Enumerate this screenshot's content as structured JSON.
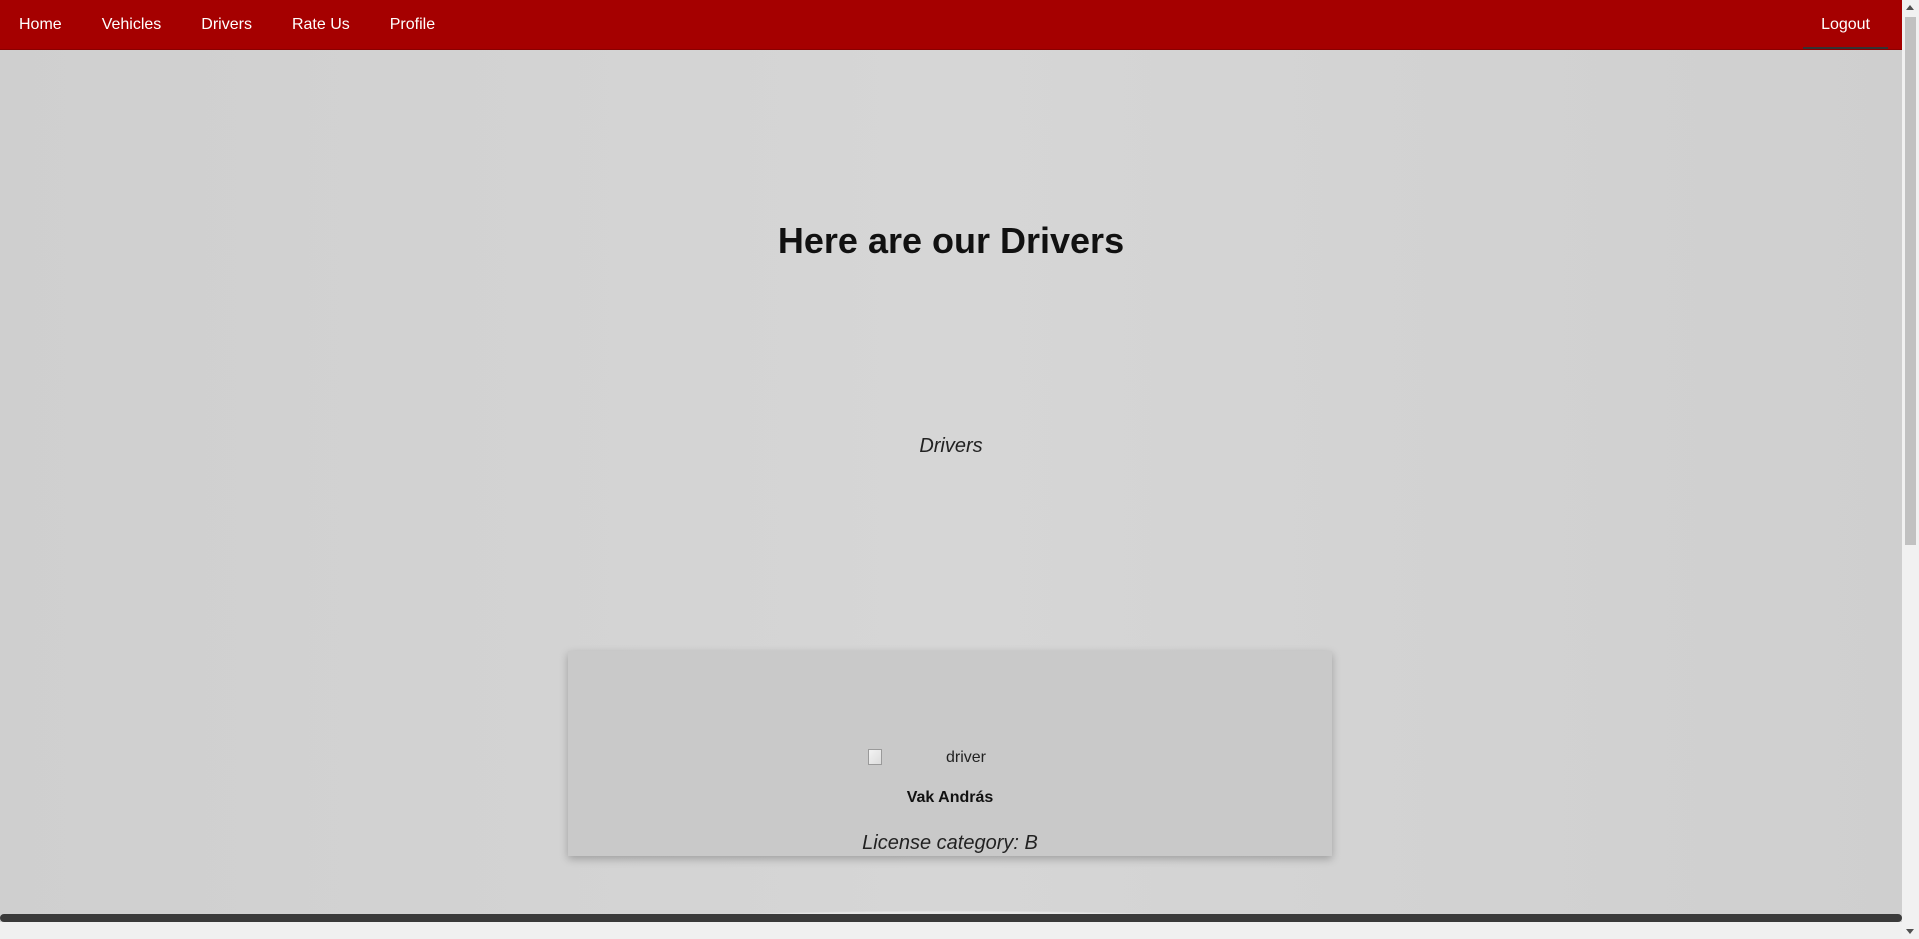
{
  "nav": {
    "items": [
      {
        "label": "Home"
      },
      {
        "label": "Vehicles"
      },
      {
        "label": "Drivers"
      },
      {
        "label": "Rate Us"
      },
      {
        "label": "Profile"
      }
    ],
    "logout_label": "Logout"
  },
  "main": {
    "title": "Here are our Drivers",
    "subtitle": "Drivers"
  },
  "drivers": [
    {
      "image_alt": "driver",
      "name": "Vak András",
      "license": "License category: B"
    }
  ],
  "colors": {
    "navbar": "#a50000",
    "card": "#c9c9c9",
    "background": "#d4d4d4"
  }
}
